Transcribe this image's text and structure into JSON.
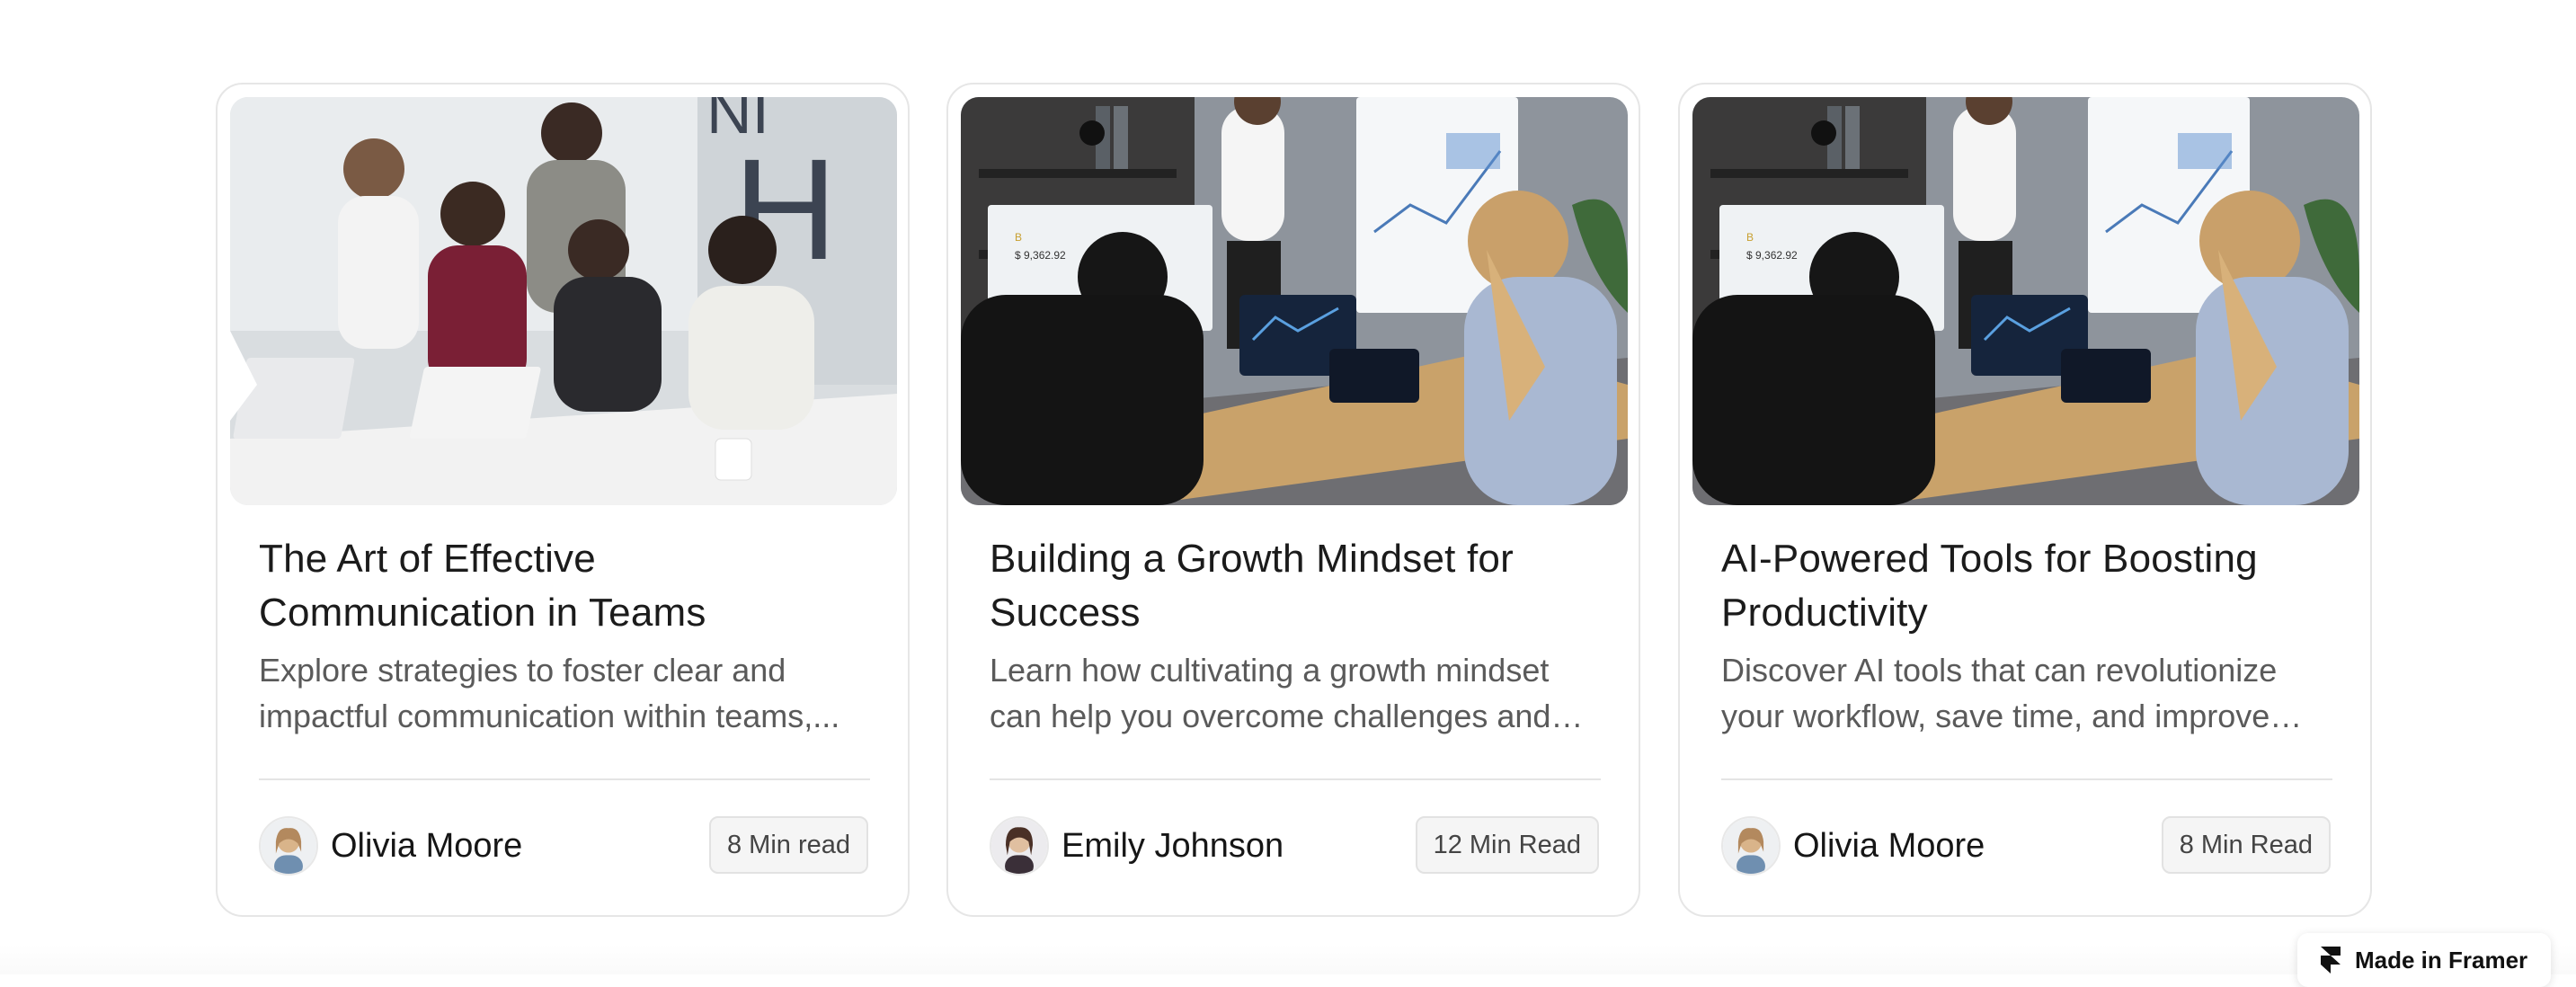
{
  "cards": [
    {
      "image": "team-meeting-laptops-photo",
      "title": "The Art of Effective Communication in Teams",
      "description": "Explore strategies to foster clear and impactful communication within teams,...",
      "author": "Olivia Moore",
      "read_time": "8 Min read"
    },
    {
      "image": "business-presentation-whiteboard-photo",
      "title": "Building a Growth Mindset for Success",
      "description": "Learn how cultivating a growth mindset can help you overcome challenges and achieve...",
      "author": "Emily Johnson",
      "read_time": "12 Min Read"
    },
    {
      "image": "business-presentation-whiteboard-photo",
      "title": "AI-Powered Tools for Boosting Productivity",
      "description": "Discover AI tools that can revolutionize your workflow, save time, and improve efficiency.",
      "author": "Olivia Moore",
      "read_time": "8 Min Read"
    }
  ],
  "framer_badge": {
    "label": "Made in Framer",
    "icon": "framer-logo-icon"
  },
  "colors": {
    "card_border": "#e6e6e6",
    "title_text": "#1b1b1b",
    "description_text": "#5a5a5a",
    "badge_background": "#f5f5f5"
  }
}
